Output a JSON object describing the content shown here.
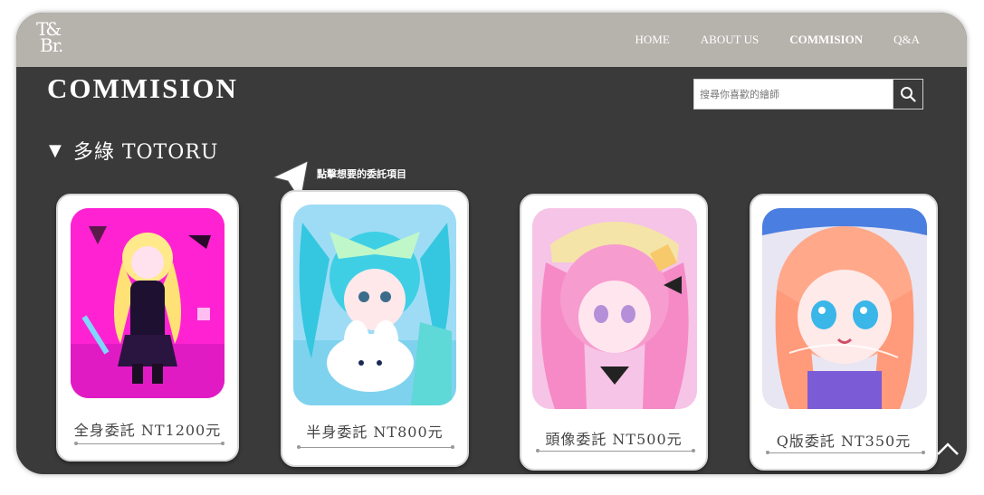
{
  "nav": {
    "logo_line1": "T&",
    "logo_line2": "Br.",
    "items": [
      {
        "label": "HOME",
        "active": false
      },
      {
        "label": "ABOUT US",
        "active": false
      },
      {
        "label": "COMMISION",
        "active": true
      },
      {
        "label": "Q&A",
        "active": false
      }
    ]
  },
  "page": {
    "title": "COMMISION",
    "search_placeholder": "搜尋你喜歡的繪師",
    "artist_marker": "▼",
    "artist_name": "多綠 TOTORU",
    "hint": "點擊想要的委託項目"
  },
  "cards": [
    {
      "label": "全身委託 NT1200元",
      "palette": [
        "#ff2ad4",
        "#d11ccd"
      ]
    },
    {
      "label": "半身委託 NT800元",
      "palette": [
        "#5fe3f0",
        "#9ad8ff"
      ]
    },
    {
      "label": "頭像委託 NT500元",
      "palette": [
        "#f7a7d6",
        "#f58fc4"
      ]
    },
    {
      "label": "Q版委託 NT350元",
      "palette": [
        "#ffb39a",
        "#ff9e8c"
      ]
    }
  ],
  "colors": {
    "header_bg": "#b6b2ac",
    "page_bg": "#3a3a3a",
    "card_bg": "#ffffff"
  }
}
